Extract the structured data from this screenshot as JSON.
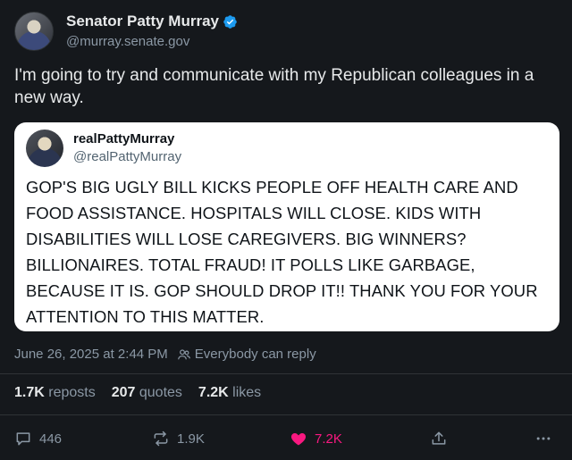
{
  "author": {
    "name": "Senator Patty Murray",
    "handle": "@murray.senate.gov"
  },
  "tweet": {
    "text": "I'm going to try and communicate with my Republican colleagues in a new way."
  },
  "quote": {
    "name": "realPattyMurray",
    "handle": "@realPattyMurray",
    "text": "GOP'S BIG UGLY BILL KICKS PEOPLE OFF HEALTH CARE AND FOOD ASSISTANCE. HOSPITALS WILL CLOSE. KIDS WITH DISABILITIES WILL LOSE CAREGIVERS. BIG WINNERS? BILLIONAIRES. TOTAL FRAUD! IT POLLS LIKE GARBAGE, BECAUSE IT IS. GOP SHOULD DROP IT!! THANK YOU FOR YOUR ATTENTION TO THIS MATTER."
  },
  "meta": {
    "timestamp": "June 26, 2025 at 2:44 PM",
    "reply_setting": "Everybody can reply"
  },
  "stats": {
    "reposts_count": "1.7K",
    "reposts_label": "reposts",
    "quotes_count": "207",
    "quotes_label": "quotes",
    "likes_count": "7.2K",
    "likes_label": "likes"
  },
  "actions": {
    "replies": "446",
    "reposts": "1.9K",
    "likes": "7.2K"
  },
  "colors": {
    "background": "#15181c",
    "verified": "#1d9bf0",
    "like": "#f91880",
    "muted": "#8b98a5"
  },
  "icons": [
    "verified-badge-icon",
    "people-icon",
    "reply-icon",
    "repost-icon",
    "heart-icon",
    "share-icon",
    "more-icon"
  ]
}
